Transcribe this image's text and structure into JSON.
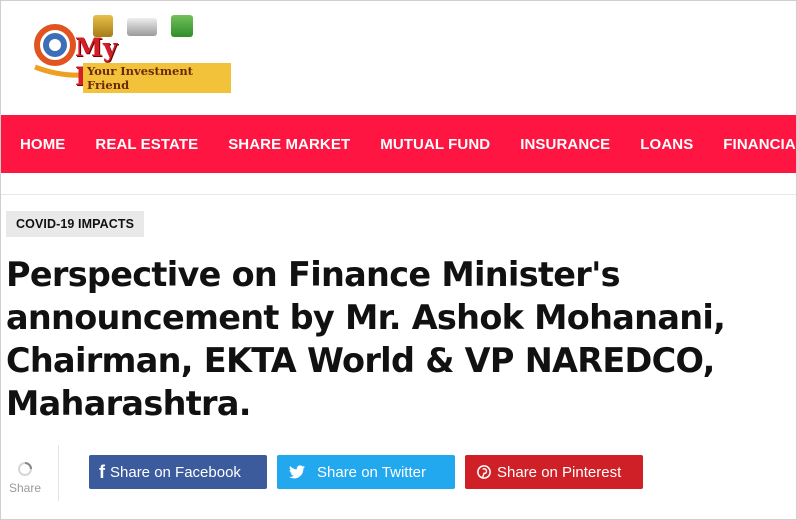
{
  "logo": {
    "title": "My Realityin",
    "tagline": "Your Investment Friend",
    "icons": [
      "coins-icon",
      "calculator-icon",
      "house-icon"
    ]
  },
  "nav": {
    "items": [
      {
        "label": "HOME"
      },
      {
        "label": "REAL ESTATE"
      },
      {
        "label": "SHARE MARKET"
      },
      {
        "label": "MUTUAL FUND"
      },
      {
        "label": "INSURANCE"
      },
      {
        "label": "LOANS"
      },
      {
        "label": "FINANCIAL PLANNING"
      }
    ],
    "color": "#ff1541"
  },
  "article": {
    "category": "COVID-19 IMPACTS",
    "title": "Perspective on Finance Minister's announcement by Mr. Ashok Mohanani, Chairman, EKTA World & VP NAREDCO, Maharashtra."
  },
  "share": {
    "count_label": "Share",
    "facebook": {
      "label": "Share on Facebook",
      "icon": "facebook-icon",
      "color": "#3b5b9c"
    },
    "twitter": {
      "label": "Share on Twitter",
      "icon": "twitter-icon",
      "color": "#21a8ee"
    },
    "pinterest": {
      "label": "Share on Pinterest",
      "icon": "pinterest-icon",
      "color": "#cf2027"
    }
  }
}
